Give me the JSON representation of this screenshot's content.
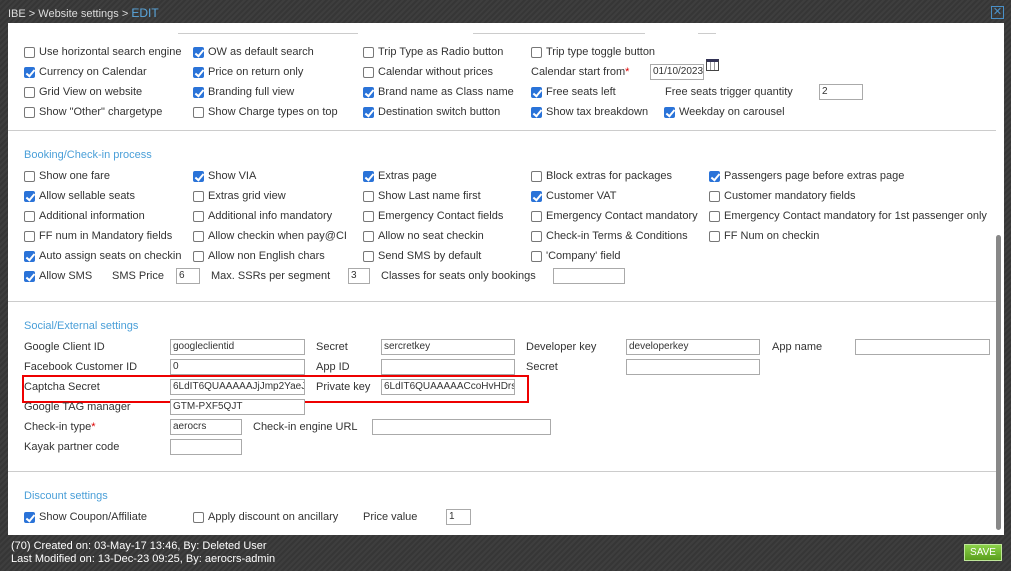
{
  "header": {
    "breadcrumb": "IBE > Website settings > ",
    "current": "EDIT"
  },
  "general": [
    [
      {
        "t": "cb",
        "label": "Use horizontal search engine",
        "checked": false
      },
      {
        "t": "cb",
        "label": "OW as default search",
        "checked": true
      },
      {
        "t": "cb",
        "label": "Trip Type as Radio button",
        "checked": false
      },
      {
        "t": "cb",
        "label": "Trip type toggle button",
        "checked": false
      }
    ],
    [
      {
        "t": "cb",
        "label": "Currency on Calendar",
        "checked": true
      },
      {
        "t": "cb",
        "label": "Price on return only",
        "checked": true
      },
      {
        "t": "cb",
        "label": "Calendar without prices",
        "checked": false
      },
      {
        "t": "lbl",
        "label": "Calendar start from",
        "required": true
      },
      {
        "t": "in",
        "value": "01/10/2023"
      }
    ],
    [
      {
        "t": "cb",
        "label": "Grid View on website",
        "checked": false
      },
      {
        "t": "cb",
        "label": "Branding full view",
        "checked": true
      },
      {
        "t": "cb",
        "label": "Brand name as Class name",
        "checked": true
      },
      {
        "t": "cb",
        "label": "Free seats left",
        "checked": true
      },
      {
        "t": "lbl",
        "label": "Free seats trigger quantity"
      },
      {
        "t": "in",
        "value": "2"
      }
    ],
    [
      {
        "t": "cb",
        "label": "Show \"Other\" chargetype",
        "checked": false
      },
      {
        "t": "cb",
        "label": "Show Charge types on top",
        "checked": false
      },
      {
        "t": "cb",
        "label": "Destination switch button",
        "checked": true
      },
      {
        "t": "cb",
        "label": "Show tax breakdown",
        "checked": true
      },
      {
        "t": "cb",
        "label": "Weekday on carousel",
        "checked": true
      }
    ]
  ],
  "booking_title": "Booking/Check-in process",
  "booking": [
    [
      {
        "t": "cb",
        "label": "Show one fare",
        "checked": false
      },
      {
        "t": "cb",
        "label": "Show VIA",
        "checked": true
      },
      {
        "t": "cb",
        "label": "Extras page",
        "checked": true
      },
      {
        "t": "cb",
        "label": "Block extras for packages",
        "checked": false
      },
      {
        "t": "cb",
        "label": "Passengers page before extras page",
        "checked": true
      }
    ],
    [
      {
        "t": "cb",
        "label": "Allow sellable seats",
        "checked": true
      },
      {
        "t": "cb",
        "label": "Extras grid view",
        "checked": false
      },
      {
        "t": "cb",
        "label": "Show Last name first",
        "checked": false
      },
      {
        "t": "cb",
        "label": "Customer VAT",
        "checked": true
      },
      {
        "t": "cb",
        "label": "Customer mandatory fields",
        "checked": false
      }
    ],
    [
      {
        "t": "cb",
        "label": "Additional information",
        "checked": false
      },
      {
        "t": "cb",
        "label": "Additional info mandatory",
        "checked": false
      },
      {
        "t": "cb",
        "label": "Emergency Contact fields",
        "checked": false
      },
      {
        "t": "cb",
        "label": "Emergency Contact mandatory",
        "checked": false
      },
      {
        "t": "cb",
        "label": "Emergency Contact mandatory for 1st passenger only",
        "checked": false
      }
    ],
    [
      {
        "t": "cb",
        "label": "FF num in Mandatory fields",
        "checked": false
      },
      {
        "t": "cb",
        "label": "Allow checkin when pay@CI",
        "checked": false
      },
      {
        "t": "cb",
        "label": "Allow no seat checkin",
        "checked": false
      },
      {
        "t": "cb",
        "label": "Check-in Terms & Conditions",
        "checked": false
      },
      {
        "t": "cb",
        "label": "FF Num on checkin",
        "checked": false
      }
    ],
    [
      {
        "t": "cb",
        "label": "Auto assign seats on checkin",
        "checked": true
      },
      {
        "t": "cb",
        "label": "Allow non English chars",
        "checked": false
      },
      {
        "t": "cb",
        "label": "Send SMS by default",
        "checked": false
      },
      {
        "t": "cb",
        "label": "'Company' field",
        "checked": false
      }
    ],
    [
      {
        "t": "cb",
        "label": "Allow SMS",
        "checked": true
      },
      {
        "t": "lbl",
        "label": "SMS Price"
      },
      {
        "t": "in",
        "value": "6"
      },
      {
        "t": "lbl",
        "label": "Max. SSRs per segment"
      },
      {
        "t": "in",
        "value": "3"
      },
      {
        "t": "lbl",
        "label": "Classes for seats only bookings"
      },
      {
        "t": "in",
        "value": ""
      }
    ]
  ],
  "social_title": "Social/External settings",
  "social": [
    [
      {
        "t": "lbl",
        "label": "Google Client ID"
      },
      {
        "t": "in",
        "value": "googleclientid"
      },
      {
        "t": "lbl",
        "label": "Secret"
      },
      {
        "t": "in",
        "value": "sercretkey"
      },
      {
        "t": "lbl",
        "label": "Developer key"
      },
      {
        "t": "in",
        "value": "developerkey"
      },
      {
        "t": "lbl",
        "label": "App name"
      },
      {
        "t": "in",
        "value": ""
      }
    ],
    [
      {
        "t": "lbl",
        "label": "Facebook Customer ID"
      },
      {
        "t": "in",
        "value": "0"
      },
      {
        "t": "lbl",
        "label": "App ID"
      },
      {
        "t": "in",
        "value": ""
      },
      {
        "t": "lbl",
        "label": "Secret"
      },
      {
        "t": "in",
        "value": ""
      }
    ],
    [
      {
        "t": "lbl",
        "label": "Captcha Secret"
      },
      {
        "t": "in",
        "value": "6LdIT6QUAAAAAJjJmp2YaeJ"
      },
      {
        "t": "lbl",
        "label": "Private key"
      },
      {
        "t": "in",
        "value": "6LdIT6QUAAAAACcoHvHDrs."
      }
    ],
    [
      {
        "t": "lbl",
        "label": "Google TAG manager"
      },
      {
        "t": "in",
        "value": "GTM-PXF5QJT"
      }
    ],
    [
      {
        "t": "lbl",
        "label": "Check-in type",
        "required": true
      },
      {
        "t": "in",
        "value": "aerocrs"
      },
      {
        "t": "lbl",
        "label": "Check-in engine URL"
      },
      {
        "t": "in",
        "value": ""
      }
    ],
    [
      {
        "t": "lbl",
        "label": "Kayak partner code"
      },
      {
        "t": "in",
        "value": ""
      }
    ]
  ],
  "discount_title": "Discount settings",
  "discount": [
    [
      {
        "t": "cb",
        "label": "Show Coupon/Affiliate",
        "checked": true
      },
      {
        "t": "cb",
        "label": "Apply discount on ancillary",
        "checked": false
      },
      {
        "t": "lbl",
        "label": "Price value"
      },
      {
        "t": "in",
        "value": "1"
      }
    ]
  ],
  "footer": {
    "created": "(70) Created on: 03-May-17 13:46, By: Deleted User",
    "modified": "Last Modified on: 13-Dec-23 09:25, By: aerocrs-admin",
    "save_label": "SAVE"
  }
}
